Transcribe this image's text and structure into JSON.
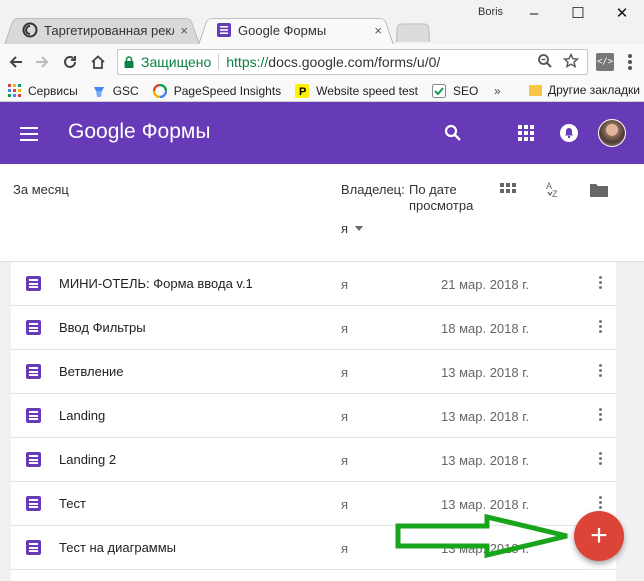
{
  "browser": {
    "tabs": [
      {
        "title": "Таргетированная рекла",
        "close": "×"
      },
      {
        "title": "Google Формы",
        "close": "×"
      }
    ],
    "window_user": "Boris",
    "window_controls": {
      "minimize": "–",
      "maximize": "☐",
      "close": "✕"
    },
    "address": {
      "security_label": "Защищено",
      "url_scheme": "https://",
      "url_rest": "docs.google.com/forms/u/0/"
    },
    "extension_label": "</>",
    "bookmarks": [
      {
        "label": "Сервисы"
      },
      {
        "label": "GSC"
      },
      {
        "label": "PageSpeed Insights"
      },
      {
        "label": "Website speed test"
      },
      {
        "label": "SEO"
      }
    ],
    "bookmarks_more": "»",
    "other_bookmarks": "Другие закладки"
  },
  "app": {
    "title_google": "Google",
    "title_product": "Формы"
  },
  "columns": {
    "period": "За месяц",
    "owner_label": "Владелец:",
    "owner_value": "я",
    "sort_label": "По дате просмотра"
  },
  "files": [
    {
      "title": "МИНИ-ОТЕЛЬ: Форма ввода v.1",
      "owner": "я",
      "date": "21 мар. 2018 г."
    },
    {
      "title": "Ввод Фильтры",
      "owner": "я",
      "date": "18 мар. 2018 г."
    },
    {
      "title": "Ветвление",
      "owner": "я",
      "date": "13 мар. 2018 г."
    },
    {
      "title": "Landing",
      "owner": "я",
      "date": "13 мар. 2018 г."
    },
    {
      "title": "Landing 2",
      "owner": "я",
      "date": "13 мар. 2018 г."
    },
    {
      "title": "Тест",
      "owner": "я",
      "date": "13 мар. 2018 г."
    },
    {
      "title": "Тест на диаграммы",
      "owner": "я",
      "date": "13 мар. 2018 г."
    }
  ],
  "fab": {
    "label": "+"
  },
  "colors": {
    "forms_purple": "#673ab7",
    "fab_red": "#db4437",
    "annotation_green": "#18a51c",
    "secure_green": "#0b8043"
  }
}
